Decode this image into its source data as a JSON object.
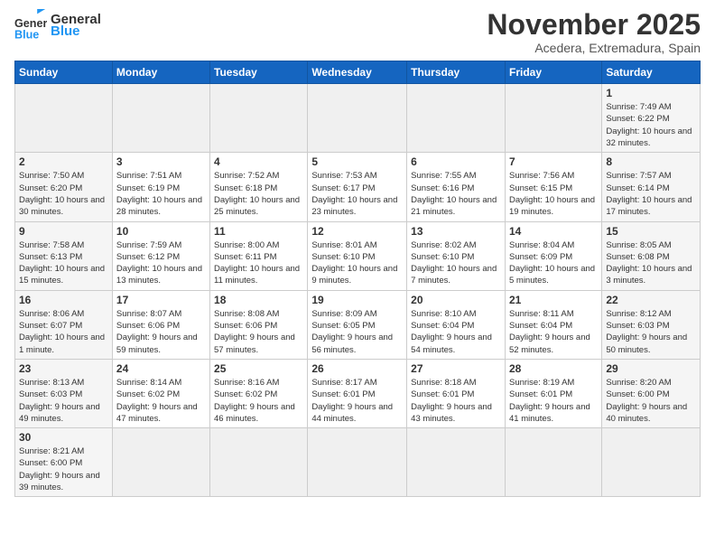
{
  "header": {
    "logo_general": "General",
    "logo_blue": "Blue",
    "month_title": "November 2025",
    "location": "Acedera, Extremadura, Spain"
  },
  "calendar": {
    "days_of_week": [
      "Sunday",
      "Monday",
      "Tuesday",
      "Wednesday",
      "Thursday",
      "Friday",
      "Saturday"
    ],
    "weeks": [
      [
        {
          "day": "",
          "info": ""
        },
        {
          "day": "",
          "info": ""
        },
        {
          "day": "",
          "info": ""
        },
        {
          "day": "",
          "info": ""
        },
        {
          "day": "",
          "info": ""
        },
        {
          "day": "",
          "info": ""
        },
        {
          "day": "1",
          "info": "Sunrise: 7:49 AM\nSunset: 6:22 PM\nDaylight: 10 hours and 32 minutes."
        }
      ],
      [
        {
          "day": "2",
          "info": "Sunrise: 7:50 AM\nSunset: 6:20 PM\nDaylight: 10 hours and 30 minutes."
        },
        {
          "day": "3",
          "info": "Sunrise: 7:51 AM\nSunset: 6:19 PM\nDaylight: 10 hours and 28 minutes."
        },
        {
          "day": "4",
          "info": "Sunrise: 7:52 AM\nSunset: 6:18 PM\nDaylight: 10 hours and 25 minutes."
        },
        {
          "day": "5",
          "info": "Sunrise: 7:53 AM\nSunset: 6:17 PM\nDaylight: 10 hours and 23 minutes."
        },
        {
          "day": "6",
          "info": "Sunrise: 7:55 AM\nSunset: 6:16 PM\nDaylight: 10 hours and 21 minutes."
        },
        {
          "day": "7",
          "info": "Sunrise: 7:56 AM\nSunset: 6:15 PM\nDaylight: 10 hours and 19 minutes."
        },
        {
          "day": "8",
          "info": "Sunrise: 7:57 AM\nSunset: 6:14 PM\nDaylight: 10 hours and 17 minutes."
        }
      ],
      [
        {
          "day": "9",
          "info": "Sunrise: 7:58 AM\nSunset: 6:13 PM\nDaylight: 10 hours and 15 minutes."
        },
        {
          "day": "10",
          "info": "Sunrise: 7:59 AM\nSunset: 6:12 PM\nDaylight: 10 hours and 13 minutes."
        },
        {
          "day": "11",
          "info": "Sunrise: 8:00 AM\nSunset: 6:11 PM\nDaylight: 10 hours and 11 minutes."
        },
        {
          "day": "12",
          "info": "Sunrise: 8:01 AM\nSunset: 6:10 PM\nDaylight: 10 hours and 9 minutes."
        },
        {
          "day": "13",
          "info": "Sunrise: 8:02 AM\nSunset: 6:10 PM\nDaylight: 10 hours and 7 minutes."
        },
        {
          "day": "14",
          "info": "Sunrise: 8:04 AM\nSunset: 6:09 PM\nDaylight: 10 hours and 5 minutes."
        },
        {
          "day": "15",
          "info": "Sunrise: 8:05 AM\nSunset: 6:08 PM\nDaylight: 10 hours and 3 minutes."
        }
      ],
      [
        {
          "day": "16",
          "info": "Sunrise: 8:06 AM\nSunset: 6:07 PM\nDaylight: 10 hours and 1 minute."
        },
        {
          "day": "17",
          "info": "Sunrise: 8:07 AM\nSunset: 6:06 PM\nDaylight: 9 hours and 59 minutes."
        },
        {
          "day": "18",
          "info": "Sunrise: 8:08 AM\nSunset: 6:06 PM\nDaylight: 9 hours and 57 minutes."
        },
        {
          "day": "19",
          "info": "Sunrise: 8:09 AM\nSunset: 6:05 PM\nDaylight: 9 hours and 56 minutes."
        },
        {
          "day": "20",
          "info": "Sunrise: 8:10 AM\nSunset: 6:04 PM\nDaylight: 9 hours and 54 minutes."
        },
        {
          "day": "21",
          "info": "Sunrise: 8:11 AM\nSunset: 6:04 PM\nDaylight: 9 hours and 52 minutes."
        },
        {
          "day": "22",
          "info": "Sunrise: 8:12 AM\nSunset: 6:03 PM\nDaylight: 9 hours and 50 minutes."
        }
      ],
      [
        {
          "day": "23",
          "info": "Sunrise: 8:13 AM\nSunset: 6:03 PM\nDaylight: 9 hours and 49 minutes."
        },
        {
          "day": "24",
          "info": "Sunrise: 8:14 AM\nSunset: 6:02 PM\nDaylight: 9 hours and 47 minutes."
        },
        {
          "day": "25",
          "info": "Sunrise: 8:16 AM\nSunset: 6:02 PM\nDaylight: 9 hours and 46 minutes."
        },
        {
          "day": "26",
          "info": "Sunrise: 8:17 AM\nSunset: 6:01 PM\nDaylight: 9 hours and 44 minutes."
        },
        {
          "day": "27",
          "info": "Sunrise: 8:18 AM\nSunset: 6:01 PM\nDaylight: 9 hours and 43 minutes."
        },
        {
          "day": "28",
          "info": "Sunrise: 8:19 AM\nSunset: 6:01 PM\nDaylight: 9 hours and 41 minutes."
        },
        {
          "day": "29",
          "info": "Sunrise: 8:20 AM\nSunset: 6:00 PM\nDaylight: 9 hours and 40 minutes."
        }
      ],
      [
        {
          "day": "30",
          "info": "Sunrise: 8:21 AM\nSunset: 6:00 PM\nDaylight: 9 hours and 39 minutes."
        },
        {
          "day": "",
          "info": ""
        },
        {
          "day": "",
          "info": ""
        },
        {
          "day": "",
          "info": ""
        },
        {
          "day": "",
          "info": ""
        },
        {
          "day": "",
          "info": ""
        },
        {
          "day": "",
          "info": ""
        }
      ]
    ]
  }
}
